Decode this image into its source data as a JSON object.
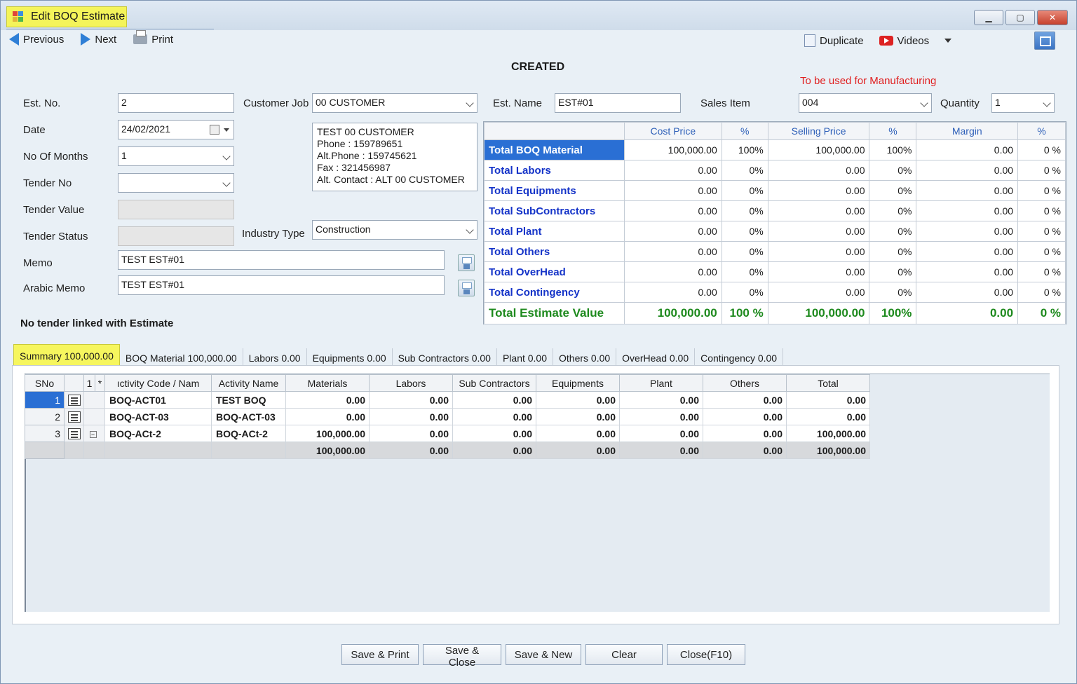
{
  "window": {
    "title": "Edit BOQ Estimate"
  },
  "toolbar": {
    "previous": "Previous",
    "next": "Next",
    "print": "Print",
    "duplicate": "Duplicate",
    "videos": "Videos"
  },
  "status": "CREATED",
  "manufacturing_note": "To be used for Manufacturing",
  "form": {
    "est_no_label": "Est. No.",
    "est_no": "2",
    "date_label": "Date",
    "date": "24/02/2021",
    "months_label": "No Of Months",
    "months": "1",
    "tender_no_label": "Tender No",
    "tender_no": "",
    "tender_value_label": "Tender Value",
    "tender_status_label": "Tender Status",
    "memo_label": "Memo",
    "memo": "TEST EST#01",
    "arabic_memo_label": "Arabic Memo",
    "arabic_memo": "TEST EST#01",
    "customer_job_label": "Customer Job",
    "customer_job": "00 CUSTOMER",
    "customer_info": [
      "TEST 00 CUSTOMER",
      "Phone : 159789651",
      "Alt.Phone : 159745621",
      "Fax : 321456987",
      "Alt. Contact : ALT 00 CUSTOMER"
    ],
    "industry_type_label": "Industry Type",
    "industry_type": "Construction",
    "est_name_label": "Est. Name",
    "est_name": "EST#01",
    "sales_item_label": "Sales Item",
    "sales_item": "004",
    "quantity_label": "Quantity",
    "quantity": "1",
    "no_tender_msg": "No tender linked with Estimate"
  },
  "totals": {
    "headers": [
      "Cost Price",
      "%",
      "Selling Price",
      "%",
      "Margin",
      "%"
    ],
    "rows": [
      {
        "label": "Total BOQ Material",
        "cost": "100,000.00",
        "cost_pct": "100%",
        "sell": "100,000.00",
        "sell_pct": "100%",
        "margin": "0.00",
        "margin_pct": "0 %"
      },
      {
        "label": "Total Labors",
        "cost": "0.00",
        "cost_pct": "0%",
        "sell": "0.00",
        "sell_pct": "0%",
        "margin": "0.00",
        "margin_pct": "0 %"
      },
      {
        "label": "Total Equipments",
        "cost": "0.00",
        "cost_pct": "0%",
        "sell": "0.00",
        "sell_pct": "0%",
        "margin": "0.00",
        "margin_pct": "0 %"
      },
      {
        "label": "Total SubContractors",
        "cost": "0.00",
        "cost_pct": "0%",
        "sell": "0.00",
        "sell_pct": "0%",
        "margin": "0.00",
        "margin_pct": "0 %"
      },
      {
        "label": "Total Plant",
        "cost": "0.00",
        "cost_pct": "0%",
        "sell": "0.00",
        "sell_pct": "0%",
        "margin": "0.00",
        "margin_pct": "0 %"
      },
      {
        "label": "Total Others",
        "cost": "0.00",
        "cost_pct": "0%",
        "sell": "0.00",
        "sell_pct": "0%",
        "margin": "0.00",
        "margin_pct": "0 %"
      },
      {
        "label": "Total OverHead",
        "cost": "0.00",
        "cost_pct": "0%",
        "sell": "0.00",
        "sell_pct": "0%",
        "margin": "0.00",
        "margin_pct": "0 %"
      },
      {
        "label": "Total Contingency",
        "cost": "0.00",
        "cost_pct": "0%",
        "sell": "0.00",
        "sell_pct": "0%",
        "margin": "0.00",
        "margin_pct": "0 %"
      }
    ],
    "total": {
      "label": "Total Estimate Value",
      "cost": "100,000.00",
      "cost_pct": "100 %",
      "sell": "100,000.00",
      "sell_pct": "100%",
      "margin": "0.00",
      "margin_pct": "0 %"
    }
  },
  "tabs": [
    "Summary 100,000.00",
    "BOQ Material  100,000.00",
    "Labors 0.00",
    "Equipments 0.00",
    "Sub Contractors 0.00",
    "Plant  0.00",
    "Others  0.00",
    "OverHead 0.00",
    "Contingency 0.00"
  ],
  "grid": {
    "headers": [
      "SNo",
      "",
      "1",
      "*",
      "ıctivity Code / Nam",
      "Activity Name",
      "Materials",
      "Labors",
      "Sub Contractors",
      "Equipments",
      "Plant",
      "Others",
      "Total"
    ],
    "rows": [
      {
        "sno": "1",
        "code": "BOQ-ACT01",
        "name": "TEST BOQ",
        "materials": "0.00",
        "labors": "0.00",
        "sub": "0.00",
        "equip": "0.00",
        "plant": "0.00",
        "others": "0.00",
        "total": "0.00"
      },
      {
        "sno": "2",
        "code": "BOQ-ACT-03",
        "name": "BOQ-ACT-03",
        "materials": "0.00",
        "labors": "0.00",
        "sub": "0.00",
        "equip": "0.00",
        "plant": "0.00",
        "others": "0.00",
        "total": "0.00"
      },
      {
        "sno": "3",
        "code": "BOQ-ACt-2",
        "name": "BOQ-ACt-2",
        "materials": "100,000.00",
        "labors": "0.00",
        "sub": "0.00",
        "equip": "0.00",
        "plant": "0.00",
        "others": "0.00",
        "total": "100,000.00"
      }
    ],
    "footer": {
      "materials": "100,000.00",
      "labors": "0.00",
      "sub": "0.00",
      "equip": "0.00",
      "plant": "0.00",
      "others": "0.00",
      "total": "100,000.00"
    },
    "expander": "−"
  },
  "buttons": [
    "Save & Print",
    "Save & Close",
    "Save & New",
    "Clear",
    "Close(F10)"
  ]
}
